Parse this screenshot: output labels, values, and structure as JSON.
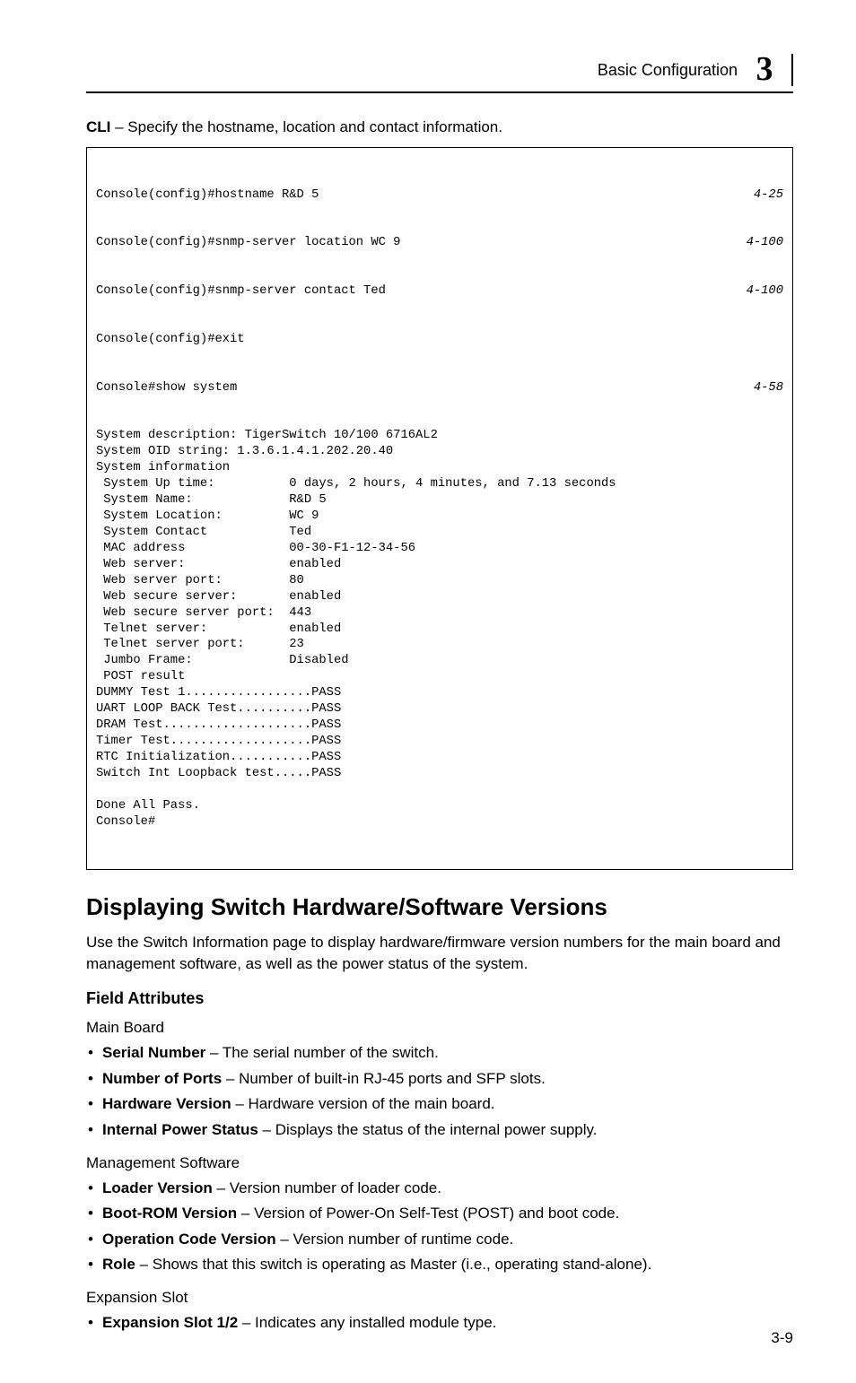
{
  "header": {
    "section": "Basic Configuration",
    "chapter_number": "3"
  },
  "cli_intro": {
    "bold": "CLI",
    "rest": " – Specify the hostname, location and contact information."
  },
  "cli_lines": [
    {
      "text": "Console(config)#hostname R&D 5",
      "ref": "4-25"
    },
    {
      "text": "Console(config)#snmp-server location WC 9",
      "ref": "4-100"
    },
    {
      "text": "Console(config)#snmp-server contact Ted",
      "ref": "4-100"
    },
    {
      "text": "Console(config)#exit",
      "ref": ""
    },
    {
      "text": "Console#show system",
      "ref": "4-58"
    }
  ],
  "cli_body": "System description: TigerSwitch 10/100 6716AL2\nSystem OID string: 1.3.6.1.4.1.202.20.40\nSystem information\n System Up time:          0 days, 2 hours, 4 minutes, and 7.13 seconds\n System Name:             R&D 5\n System Location:         WC 9\n System Contact           Ted\n MAC address              00-30-F1-12-34-56\n Web server:              enabled\n Web server port:         80\n Web secure server:       enabled\n Web secure server port:  443\n Telnet server:           enabled\n Telnet server port:      23\n Jumbo Frame:             Disabled\n POST result\nDUMMY Test 1.................PASS\nUART LOOP BACK Test..........PASS\nDRAM Test....................PASS\nTimer Test...................PASS\nRTC Initialization...........PASS\nSwitch Int Loopback test.....PASS\n\nDone All Pass.\nConsole#",
  "section_title": "Displaying Switch Hardware/Software Versions",
  "section_intro": "Use the Switch Information page to display hardware/firmware version numbers for the main board and management software, as well as the power status of the system.",
  "field_attributes_title": "Field Attributes",
  "main_board": {
    "title": "Main Board",
    "items": [
      {
        "bold": "Serial Number",
        "rest": " – The serial number of the switch."
      },
      {
        "bold": "Number of Ports",
        "rest": " – Number of built-in RJ-45 ports and SFP slots."
      },
      {
        "bold": "Hardware Version",
        "rest": " – Hardware version of the main board."
      },
      {
        "bold": "Internal Power Status",
        "rest": " – Displays the status of the internal power supply."
      }
    ]
  },
  "mgmt_software": {
    "title": "Management Software",
    "items": [
      {
        "bold": "Loader Version",
        "rest": " – Version number of loader code."
      },
      {
        "bold": "Boot-ROM Version",
        "rest": " – Version of Power-On Self-Test (POST) and boot code."
      },
      {
        "bold": "Operation Code Version",
        "rest": " – Version number of runtime code."
      },
      {
        "bold": "Role",
        "rest": " – Shows that this switch is operating as Master (i.e., operating stand-alone)."
      }
    ]
  },
  "expansion_slot": {
    "title": "Expansion Slot",
    "items": [
      {
        "bold": "Expansion Slot 1/2",
        "rest": " – Indicates any installed module type."
      }
    ]
  },
  "page_number": "3-9"
}
